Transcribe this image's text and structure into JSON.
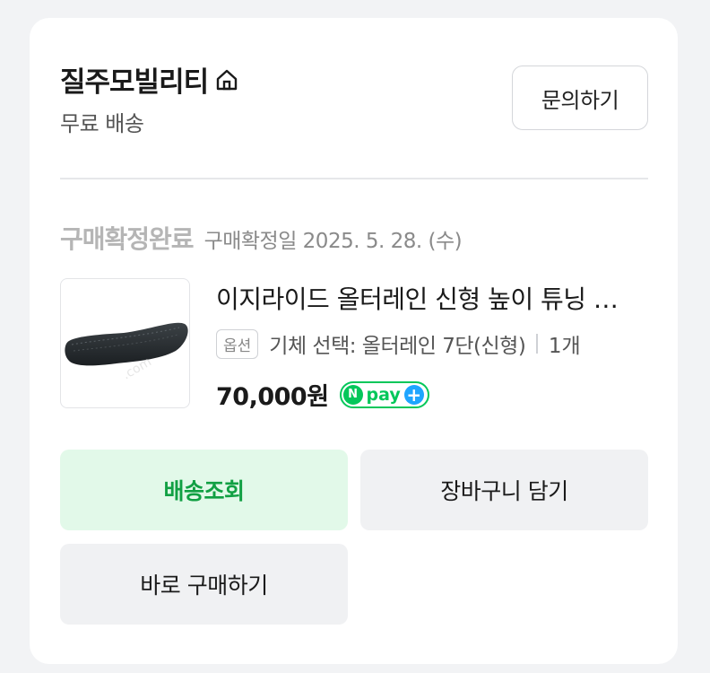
{
  "store": {
    "name": "질주모빌리티",
    "shipping": "무료 배송",
    "inquiry_label": "문의하기"
  },
  "order": {
    "status": "구매확정완료",
    "confirm_date": "구매확정일 2025. 5. 28. (수)"
  },
  "product": {
    "name": "이지라이드 올터레인 신형 높이 튜닝 …",
    "option_badge": "옵션",
    "option_text": "기체 선택: 올터레인 7단(신형)",
    "quantity": "1개",
    "price": "70,000원",
    "pay_badge": "pay",
    "pay_badge_n": "N",
    "pay_badge_plus": "+"
  },
  "actions": {
    "track_label": "배송조회",
    "cart_label": "장바구니 담기",
    "buy_label": "바로 구매하기"
  },
  "colors": {
    "accent_green": "#03c75a",
    "track_bg": "#e2f9e9",
    "track_text": "#11a043",
    "npay_plus": "#1ea5ff"
  }
}
